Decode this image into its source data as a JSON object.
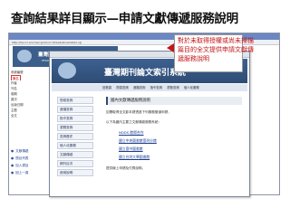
{
  "slide": {
    "title": "查詢結果詳目顯示—申請文獻傳遞服務說明"
  },
  "callout": {
    "lines": [
      "對於未取得授權或尚未掃描",
      "篇目的全文提供申請文獻傳",
      "遞服務說明"
    ]
  },
  "back_window": {
    "address": "http://tw.ncl.edu.tw/cgi-bin/ncl3/web/showdetail.cgi",
    "banner_title": "臺灣期刊論文索引系統",
    "banner_sub": "PERIODICALS INDEX",
    "detail_rows": [
      {
        "label": "系統編號",
        "value": "",
        "highlight": false
      },
      {
        "label": "篇名",
        "value": "",
        "highlight": true
      },
      {
        "label": "作者",
        "value": "",
        "highlight": false
      },
      {
        "label": "刊名",
        "value": "",
        "highlight": false
      },
      {
        "label": "卷期",
        "value": "",
        "highlight": false
      },
      {
        "label": "頁次",
        "value": "",
        "highlight": false
      },
      {
        "label": "出版日期",
        "value": "",
        "highlight": false
      },
      {
        "label": "主題",
        "value": "",
        "highlight": false
      },
      {
        "label": "全文",
        "value": "",
        "highlight": false
      }
    ],
    "left_links": [
      "文獻傳遞",
      "簡目列表",
      "加入書目",
      "回上一頁"
    ]
  },
  "front_window": {
    "banner_title": "臺灣期刊論文索引系統",
    "menu": [
      "回首頁",
      "簡易查詢",
      "進階查詢",
      "指令查詢",
      "瀏覽查詢",
      "個人化服務"
    ],
    "sidebar": [
      "簡易查詢",
      "進階查詢",
      "指令查詢",
      "瀏覽查詢",
      "查詢歷史",
      "個人化服務",
      "文獻傳遞",
      "期刊目次",
      "使用說明"
    ],
    "content_title": "國內文獻傳遞服務說明",
    "paragraphs": [
      "如需取得全文影本請透過下列服務管道申請，",
      "以下為國內主要之文獻傳遞服務系統：",
      "提供線上申請及付費說明。"
    ],
    "links": [
      "NDDS 館際合作",
      "國立中央圖書館臺灣分館",
      "國立臺中圖書館",
      "國立台灣大學圖書館"
    ]
  },
  "colors": {
    "callout_text": "#c41414",
    "banner": "#2e4c74"
  }
}
